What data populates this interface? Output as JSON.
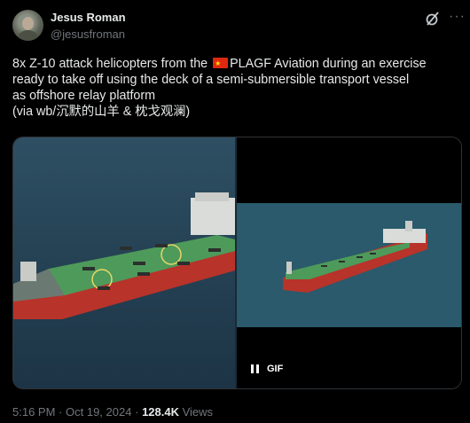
{
  "author": {
    "name": "Jesus Roman",
    "handle": "@jesusfroman"
  },
  "tweet": {
    "line1_pre": "8x Z-10 attack helicopters from the ",
    "line1_post": "PLAGF Aviation during an exercise",
    "line2": "ready to take off using the deck of a semi-submersible transport vessel",
    "line3": "as offshore relay platform",
    "line4": "(via wb/沉默的山羊 & 枕戈观澜)"
  },
  "media": {
    "gif_label": "GIF"
  },
  "meta": {
    "time": "5:16 PM",
    "date": "Oct 19, 2024",
    "sep": "·",
    "views_count": "128.4K",
    "views_label": "Views"
  },
  "icons": {
    "flag": "china-flag-icon",
    "grok": "grok-icon",
    "more": "more-icon",
    "pause": "pause-icon"
  }
}
